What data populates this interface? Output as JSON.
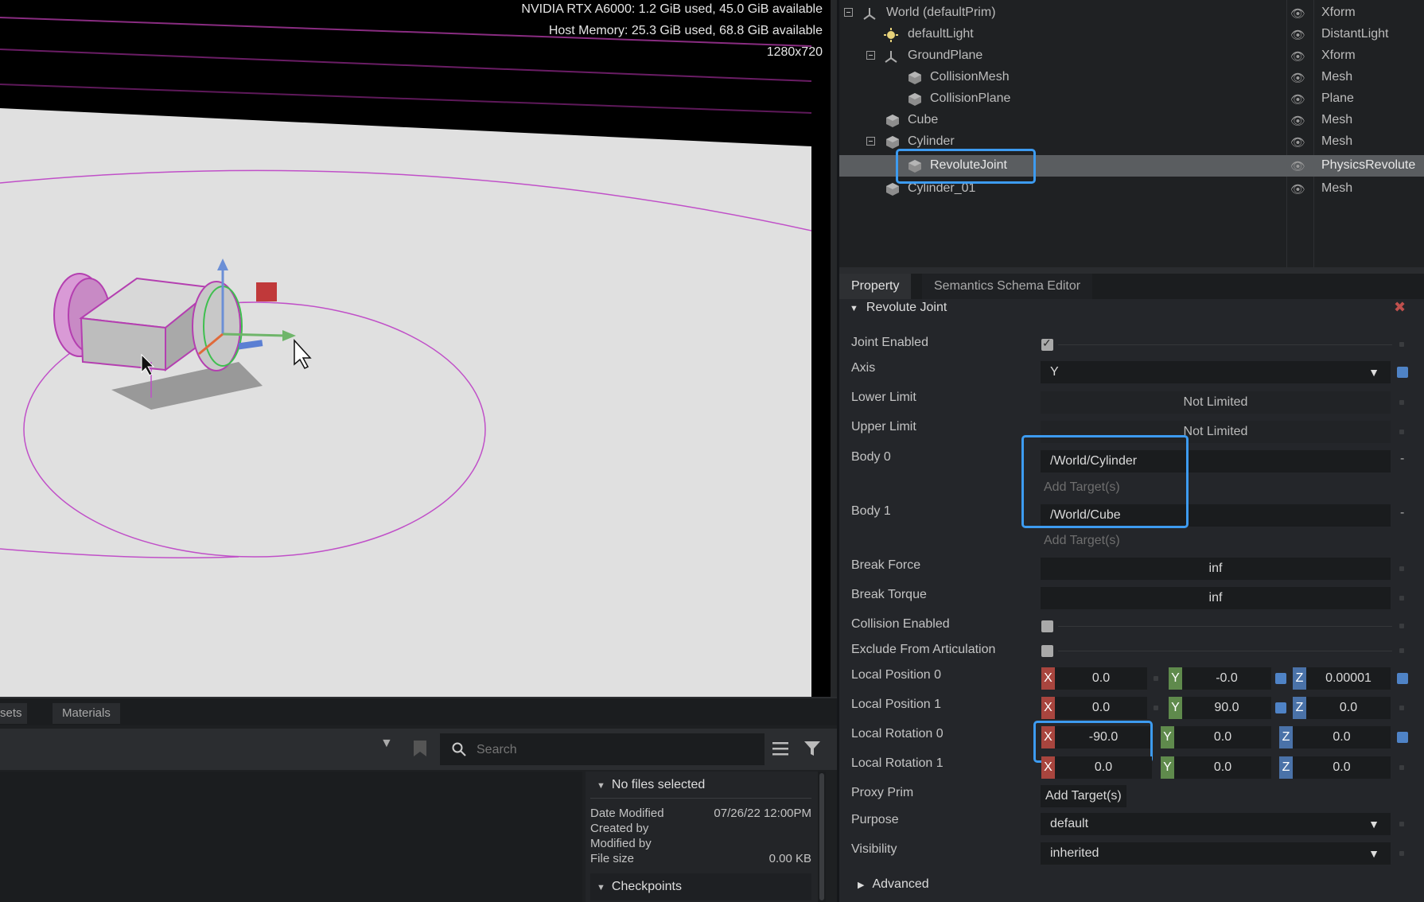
{
  "viewport": {
    "gpu_stats": "NVIDIA RTX A6000: 1.2 GiB used,  45.0 GiB available",
    "host_memory": "Host Memory: 25.3 GiB used, 68.8 GiB available",
    "resolution": "1280x720"
  },
  "content_browser": {
    "tabs": [
      "sets",
      "Materials"
    ],
    "search_placeholder": "Search",
    "details_header": "No files selected",
    "date_modified_label": "Date Modified",
    "date_modified_value": "07/26/22 12:00PM",
    "created_by_label": "Created by",
    "modified_by_label": "Modified by",
    "file_size_label": "File size",
    "file_size_value": "0.00 KB",
    "checkpoints_label": "Checkpoints"
  },
  "stage": {
    "rows": [
      {
        "name": "World (defaultPrim)",
        "type": "Xform"
      },
      {
        "name": "defaultLight",
        "type": "DistantLight"
      },
      {
        "name": "GroundPlane",
        "type": "Xform"
      },
      {
        "name": "CollisionMesh",
        "type": "Mesh"
      },
      {
        "name": "CollisionPlane",
        "type": "Plane"
      },
      {
        "name": "Cube",
        "type": "Mesh"
      },
      {
        "name": "Cylinder",
        "type": "Mesh"
      },
      {
        "name": "RevoluteJoint",
        "type": "PhysicsRevolute"
      },
      {
        "name": "Cylinder_01",
        "type": "Mesh"
      }
    ]
  },
  "property_tabs": [
    "Property",
    "Semantics Schema Editor"
  ],
  "property": {
    "section_title": "Revolute Joint",
    "joint_enabled_label": "Joint Enabled",
    "axis_label": "Axis",
    "axis_value": "Y",
    "lower_limit_label": "Lower Limit",
    "lower_limit_value": "Not Limited",
    "upper_limit_label": "Upper Limit",
    "upper_limit_value": "Not Limited",
    "body0_label": "Body 0",
    "body0_value": "/World/Cylinder",
    "body1_label": "Body 1",
    "body1_value": "/World/Cube",
    "add_targets": "Add Target(s)",
    "break_force_label": "Break Force",
    "break_force_value": "inf",
    "break_torque_label": "Break Torque",
    "break_torque_value": "inf",
    "collision_enabled_label": "Collision Enabled",
    "exclude_label": "Exclude From Articulation",
    "local_position0_label": "Local Position 0",
    "local_position0": {
      "x": "0.0",
      "y": "-0.0",
      "z": "0.00001"
    },
    "local_position1_label": "Local Position 1",
    "local_position1": {
      "x": "0.0",
      "y": "90.0",
      "z": "0.0"
    },
    "local_rotation0_label": "Local Rotation 0",
    "local_rotation0": {
      "x": "-90.0",
      "y": "0.0",
      "z": "0.0"
    },
    "local_rotation1_label": "Local Rotation 1",
    "local_rotation1": {
      "x": "0.0",
      "y": "0.0",
      "z": "0.0"
    },
    "proxy_prim_label": "Proxy Prim",
    "purpose_label": "Purpose",
    "purpose_value": "default",
    "visibility_label": "Visibility",
    "visibility_value": "inherited",
    "advanced_label": "Advanced",
    "axis_letters": {
      "x": "X",
      "y": "Y",
      "z": "Z"
    }
  },
  "colors": {
    "highlight": "#3d9bf0",
    "selection": "#5a5d60",
    "accent_blue": "#4f83c6"
  }
}
